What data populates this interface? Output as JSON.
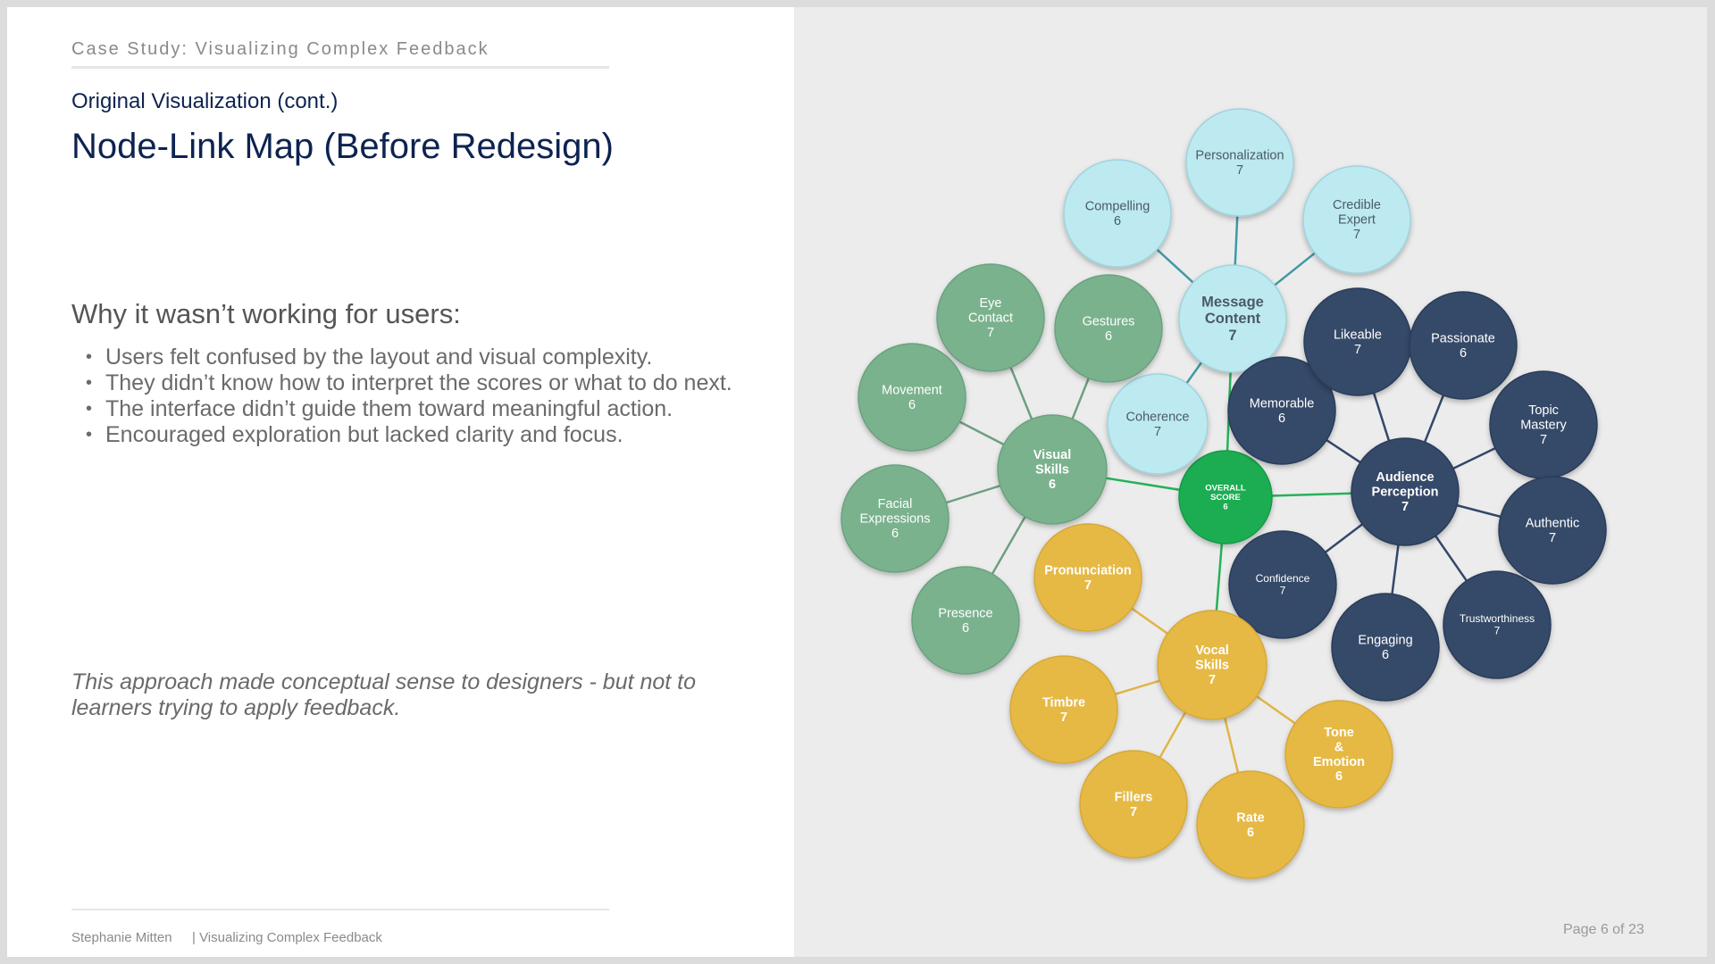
{
  "header": {
    "case_study": "Case Study: Visualizing Complex Feedback",
    "subtitle": "Original Visualization (cont.)",
    "title": "Node-Link Map (Before Redesign)"
  },
  "main": {
    "why_heading": "Why it wasn’t working for users:",
    "bullets": [
      "Users felt confused by the layout and visual complexity.",
      "They didn’t know how to interpret the scores or what to do next.",
      "The interface didn’t guide them toward meaningful action.",
      "Encouraged exploration but lacked clarity and focus."
    ],
    "closing": "This approach made conceptual sense to designers - but not to learners trying to apply feedback."
  },
  "footer": {
    "author": "Stephanie Mitten",
    "deck": "| Visualizing Complex Feedback",
    "page": "Page 6 of 23"
  },
  "colors": {
    "message": "#bdeaf1",
    "visual": "#7ab28e",
    "audience": "#344868",
    "vocal": "#e6b945",
    "overall": "#1aad52"
  },
  "diagram": {
    "nodes": [
      {
        "id": "overall",
        "label": "OVERALL\nSCORE",
        "score": "6",
        "group": "overall"
      },
      {
        "id": "message",
        "label": "Message\nContent",
        "score": "7",
        "group": "message"
      },
      {
        "id": "personalization",
        "label": "Personalization",
        "score": "7",
        "group": "message"
      },
      {
        "id": "compelling",
        "label": "Compelling",
        "score": "6",
        "group": "message"
      },
      {
        "id": "credible",
        "label": "Credible\nExpert",
        "score": "7",
        "group": "message"
      },
      {
        "id": "coherence",
        "label": "Coherence",
        "score": "7",
        "group": "message"
      },
      {
        "id": "visual",
        "label": "Visual\nSkills",
        "score": "6",
        "group": "visual"
      },
      {
        "id": "eye",
        "label": "Eye\nContact",
        "score": "7",
        "group": "visual"
      },
      {
        "id": "gestures",
        "label": "Gestures",
        "score": "6",
        "group": "visual"
      },
      {
        "id": "movement",
        "label": "Movement",
        "score": "6",
        "group": "visual"
      },
      {
        "id": "facial",
        "label": "Facial\nExpressions",
        "score": "6",
        "group": "visual"
      },
      {
        "id": "presence",
        "label": "Presence",
        "score": "6",
        "group": "visual"
      },
      {
        "id": "audience",
        "label": "Audience\nPerception",
        "score": "7",
        "group": "audience"
      },
      {
        "id": "memorable",
        "label": "Memorable",
        "score": "6",
        "group": "audience"
      },
      {
        "id": "likeable",
        "label": "Likeable",
        "score": "7",
        "group": "audience"
      },
      {
        "id": "passionate",
        "label": "Passionate",
        "score": "6",
        "group": "audience"
      },
      {
        "id": "topic",
        "label": "Topic\nMastery",
        "score": "7",
        "group": "audience"
      },
      {
        "id": "authentic",
        "label": "Authentic",
        "score": "7",
        "group": "audience"
      },
      {
        "id": "trust",
        "label": "Trustworthiness",
        "score": "7",
        "group": "audience"
      },
      {
        "id": "engaging",
        "label": "Engaging",
        "score": "6",
        "group": "audience"
      },
      {
        "id": "confidence",
        "label": "Confidence",
        "score": "7",
        "group": "audience"
      },
      {
        "id": "vocal",
        "label": "Vocal\nSkills",
        "score": "7",
        "group": "vocal"
      },
      {
        "id": "pronunciation",
        "label": "Pronunciation",
        "score": "7",
        "group": "vocal"
      },
      {
        "id": "timbre",
        "label": "Timbre",
        "score": "7",
        "group": "vocal"
      },
      {
        "id": "fillers",
        "label": "Fillers",
        "score": "7",
        "group": "vocal"
      },
      {
        "id": "rate",
        "label": "Rate",
        "score": "6",
        "group": "vocal"
      },
      {
        "id": "tone",
        "label": "Tone\n&\nEmotion",
        "score": "6",
        "group": "vocal"
      }
    ],
    "links": [
      [
        "overall",
        "message"
      ],
      [
        "overall",
        "visual"
      ],
      [
        "overall",
        "audience"
      ],
      [
        "overall",
        "vocal"
      ],
      [
        "message",
        "personalization"
      ],
      [
        "message",
        "compelling"
      ],
      [
        "message",
        "credible"
      ],
      [
        "message",
        "coherence"
      ],
      [
        "visual",
        "eye"
      ],
      [
        "visual",
        "gestures"
      ],
      [
        "visual",
        "movement"
      ],
      [
        "visual",
        "facial"
      ],
      [
        "visual",
        "presence"
      ],
      [
        "audience",
        "memorable"
      ],
      [
        "audience",
        "likeable"
      ],
      [
        "audience",
        "passionate"
      ],
      [
        "audience",
        "topic"
      ],
      [
        "audience",
        "authentic"
      ],
      [
        "audience",
        "trust"
      ],
      [
        "audience",
        "engaging"
      ],
      [
        "audience",
        "confidence"
      ],
      [
        "vocal",
        "pronunciation"
      ],
      [
        "vocal",
        "timbre"
      ],
      [
        "vocal",
        "fillers"
      ],
      [
        "vocal",
        "rate"
      ],
      [
        "vocal",
        "tone"
      ]
    ]
  }
}
